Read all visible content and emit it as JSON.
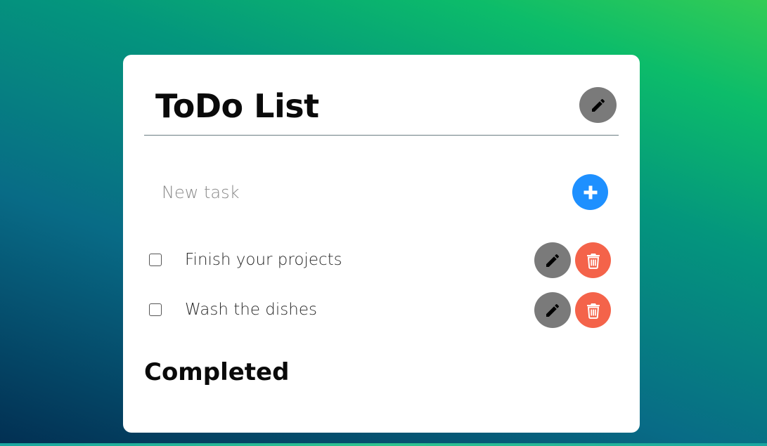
{
  "app": {
    "title": "ToDo List"
  },
  "new_task": {
    "placeholder": "New task",
    "value": ""
  },
  "tasks": [
    {
      "label": "Finish your projects",
      "checked": false
    },
    {
      "label": "Wash the dishes",
      "checked": false
    }
  ],
  "sections": {
    "completed_title": "Completed"
  },
  "icons": {
    "title_edit": "pencil-icon",
    "add": "plus-icon",
    "task_edit": "pencil-icon",
    "task_delete": "trash-icon"
  },
  "colors": {
    "edit_button": "#7a7a7a",
    "delete_button": "#f4634a",
    "add_button": "#1e90ff",
    "card": "#ffffff"
  }
}
